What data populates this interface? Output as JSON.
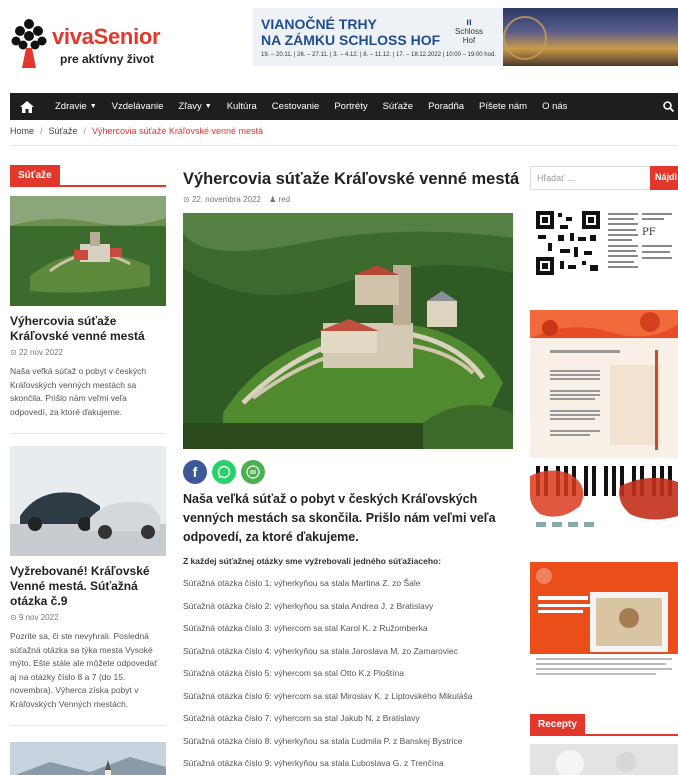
{
  "header": {
    "brand": "vivaSenior",
    "tagline": "pre aktívny život",
    "ad": {
      "line1": "VIANOČNÉ TRHY",
      "line2": "NA ZÁMKU SCHLOSS HOF",
      "dates": "19. – 20.11. | 26. – 27.11. | 3. – 4.12. | 8. – 11.12. | 17. – 18.12.2022 | 10:00 – 19:00 hod.",
      "sponsor": "Schloss Hof"
    }
  },
  "nav": {
    "items": [
      {
        "label": "Zdravie",
        "dropdown": true
      },
      {
        "label": "Vzdelávanie",
        "dropdown": false
      },
      {
        "label": "Zľavy",
        "dropdown": true
      },
      {
        "label": "Kultúra",
        "dropdown": false
      },
      {
        "label": "Cestovanie",
        "dropdown": false
      },
      {
        "label": "Portréty",
        "dropdown": false
      },
      {
        "label": "Súťaže",
        "dropdown": false
      },
      {
        "label": "Poradňa",
        "dropdown": false
      },
      {
        "label": "Píšete nám",
        "dropdown": false
      },
      {
        "label": "O nás",
        "dropdown": false
      }
    ]
  },
  "breadcrumb": {
    "home": "Home",
    "section": "Súťaže",
    "current": "Výhercovia súťaže Kráľovské venné mestá"
  },
  "left": {
    "section_label": "Súťaže",
    "posts": [
      {
        "title": "Výhercovia súťaže Kráľovské venné mestá",
        "date": "22 nov 2022",
        "excerpt": "Naša veľká súťaž o pobyt v českých Kráľovských venných mestách sa skončila. Prišlo nám veľmi veľa odpovedí, za ktoré ďakujeme."
      },
      {
        "title": "Vyžrebované! Kráľovské Venné mestá. Súťažná otázka č.9",
        "date": "9 nov 2022",
        "excerpt": "Pozrite sa, či ste nevyhrali. Posledná súťažná otázka sa týka mesta Vysoké mýto. Ešte stále ale môžete odpovedať aj na otázky číslo 8 a 7 (do 15. novembra). Výherca získa pobyt v Kráľovských Venných mestách."
      }
    ]
  },
  "article": {
    "title": "Výhercovia súťaže Kráľovské venné mestá",
    "date": "22. novembra 2022",
    "author": "red",
    "lead": "Naša veľká súťaž o pobyt v českých Kráľovských venných mestách sa skončila. Prišlo nám veľmi veľa odpovedí, za ktoré ďakujeme.",
    "subhead": "Z každej súťažnej otázky sme vyžrebovali jedného súťažiaceho:",
    "winners": [
      "Súťažná otázka číslo 1: výherkyňou sa stala Martina Z. zo Šale",
      "Súťažná otázka číslo 2: výherkyňou sa stala Andrea J. z Bratislavy",
      "Súťažná otázka číslo 3: výhercom sa stal Karol K. z Ružomberka",
      "Súťažná otázka číslo 4: výherkyňou sa stala Jaroslava M. zo Zamaroviec",
      "Súťažná otázka číslo 5: výhercom sa stal Otto K.z Ploštína",
      "Súťažná otázka číslo 6: výhercom sa stal Miroslav K. z Liptovského Mikuláša",
      "Súťažná otázka číslo 7: výhercom sa stal Jakub N. z Bratislavy",
      "Súťažná otázka číslo 8: výherkyňou sa stala Ľudmila P. z Banskej Bystrice",
      "Súťažná otázka číslo 9: výherkyňou sa stala Ľuboslava G. z Trenčína"
    ]
  },
  "sidebar": {
    "search_placeholder": "Hľadať ...",
    "search_button": "Nájdi",
    "section2_label": "Recepty"
  },
  "colors": {
    "accent": "#e2382b",
    "nav_bg": "#1e1e1e",
    "facebook": "#3b5998",
    "whatsapp": "#25d366",
    "share": "#4caf50"
  }
}
